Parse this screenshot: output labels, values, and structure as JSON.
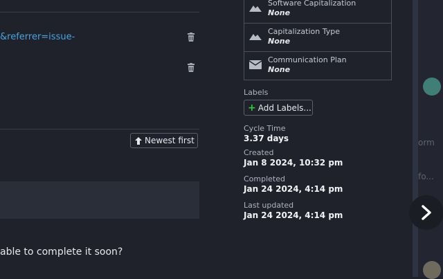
{
  "main": {
    "link_fragment": "&referrer=issue-",
    "sort_button": "Newest first",
    "comment_excerpt": "able to complete it soon?"
  },
  "fields": [
    {
      "label": "Software Capitalization",
      "value": "None",
      "icon": "mountain-icon"
    },
    {
      "label": "Capitalization Type",
      "value": "None",
      "icon": "mountain-icon"
    },
    {
      "label": "Communication Plan",
      "value": "None",
      "icon": "envelope-icon"
    }
  ],
  "labels": {
    "heading": "Labels",
    "add_button": "Add Labels..."
  },
  "meta": {
    "cycle_time_label": "Cycle Time",
    "cycle_time_value": "3.37 days",
    "created_label": "Created",
    "created_value": "Jan 8 2024, 10:32 pm",
    "completed_label": "Completed",
    "completed_value": "Jan 24 2024, 4:14 pm",
    "updated_label": "Last updated",
    "updated_value": "Jan 24 2024, 4:14 pm"
  },
  "side": {
    "text_1": "orm",
    "text_2": "fo..."
  },
  "colors": {
    "background": "#1f222b",
    "link": "#4aa3df",
    "plus": "#2ecc40"
  }
}
